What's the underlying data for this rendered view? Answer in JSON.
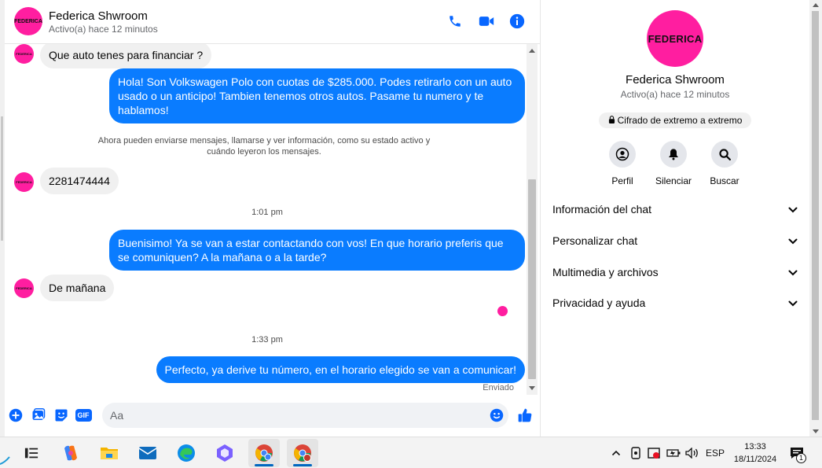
{
  "chat": {
    "header": {
      "name": "Federica Shwroom",
      "status": "Activo(a) hace 12 minutos",
      "avatar_text": "FEDERICA",
      "icons": [
        "phone-icon",
        "video-icon",
        "info-icon"
      ]
    },
    "messages": [
      {
        "dir": "in",
        "text": "Que auto tenes para financiar ?"
      },
      {
        "dir": "out",
        "text": "Hola! Son Volkswagen Polo con cuotas de $285.000. Podes retirarlo con un auto usado o un anticipo! Tambien tenemos otros autos. Pasame tu numero y te hablamos!"
      },
      {
        "dir": "system",
        "text": "Ahora pueden enviarse mensajes, llamarse y ver información, como su estado activo y cuándo leyeron los mensajes."
      },
      {
        "dir": "in",
        "text": "2281474444"
      },
      {
        "dir": "time",
        "text": "1:01 pm"
      },
      {
        "dir": "out",
        "text": "Buenisimo! Ya se van a estar contactando con vos! En que horario preferis que se comuniquen? A la mañana o a la tarde?"
      },
      {
        "dir": "in",
        "text": "De mañana"
      },
      {
        "dir": "time",
        "text": "1:33 pm"
      },
      {
        "dir": "out",
        "text": "Perfecto, ya derive tu número, en el horario elegido se van a comunicar!"
      }
    ],
    "sent_label": "Enviado",
    "composer": {
      "placeholder": "Aa",
      "gif_label": "GIF",
      "icons": [
        "plus-icon",
        "image-icon",
        "sticker-icon",
        "gif-icon",
        "emoji-icon",
        "like-icon"
      ]
    }
  },
  "info": {
    "avatar_text": "FEDERICA",
    "name": "Federica Shwroom",
    "status": "Activo(a) hace 12 minutos",
    "e2e": "Cifrado de extremo a extremo",
    "actions": [
      {
        "label": "Perfil",
        "icon": "profile-icon"
      },
      {
        "label": "Silenciar",
        "icon": "bell-icon"
      },
      {
        "label": "Buscar",
        "icon": "search-icon"
      }
    ],
    "sections": [
      {
        "label": "Información del chat"
      },
      {
        "label": "Personalizar chat"
      },
      {
        "label": "Multimedia y archivos"
      },
      {
        "label": "Privacidad y ayuda"
      }
    ]
  },
  "taskbar": {
    "apps": [
      "task-view-icon",
      "copilot-icon",
      "file-explorer-icon",
      "mail-icon",
      "edge-icon",
      "teams-icon",
      "chrome-icon",
      "chrome-profile-icon"
    ],
    "tray": {
      "lang": "ESP",
      "time": "13:33",
      "date": "18/11/2024",
      "notification_count": "1"
    }
  },
  "colors": {
    "brand_pink": "#ff1ea0",
    "outgoing_bubble": "#0a7cff",
    "incoming_bubble": "#f0f0f0",
    "accent_blue": "#0866ff"
  }
}
